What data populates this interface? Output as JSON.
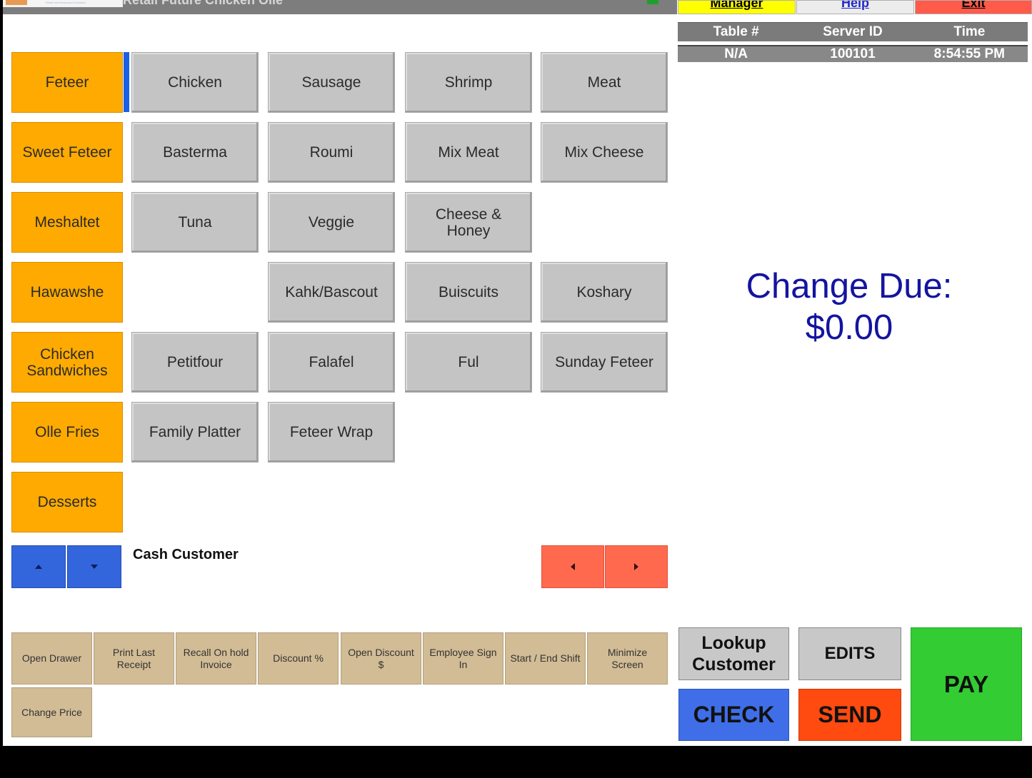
{
  "titlebar": {
    "app_title": "Retail Future  Chicken Ollé",
    "logo_tagline": "Retail and Restaurant Solutions"
  },
  "top_buttons": {
    "manager": "Manager",
    "help": "Help",
    "exit": "Exit"
  },
  "info_table": {
    "headers": [
      "Table #",
      "Server ID",
      "Time"
    ],
    "values": [
      "N/A",
      "100101",
      "8:54:55 PM"
    ]
  },
  "change_due": {
    "label": "Change Due:",
    "amount": "$0.00"
  },
  "categories": [
    "Feteer",
    "Sweet Feteer",
    "Meshaltet",
    "Hawawshe",
    "Chicken Sandwiches",
    "Olle Fries",
    "Desserts"
  ],
  "items": {
    "row1": [
      "Chicken",
      "Sausage",
      "Shrimp",
      "Meat"
    ],
    "row2": [
      "Basterma",
      "Roumi",
      "Mix Meat",
      "Mix Cheese"
    ],
    "row3": [
      "Tuna",
      "Veggie",
      "Cheese & Honey"
    ],
    "row4": [
      "Kahk/Bascout",
      "Buiscuits",
      "Koshary"
    ],
    "row5": [
      "Petitfour",
      "Falafel",
      "Ful",
      "Sunday Feteer"
    ],
    "row6": [
      "Family Platter",
      "Feteer Wrap"
    ]
  },
  "customer": {
    "name": "Cash Customer"
  },
  "function_buttons": [
    "Open Drawer",
    "Print Last Receipt",
    "Recall On hold Invoice",
    "Discount %",
    "Open Discount $",
    "Employee Sign In",
    "Start / End Shift",
    "Minimize Screen",
    "Change Price"
  ],
  "actions": {
    "lookup": "Lookup Customer",
    "edits": "EDITS",
    "check": "CHECK",
    "send": "SEND",
    "pay": "PAY"
  },
  "colors": {
    "category": "#ffaa00",
    "item": "#c4c4c4",
    "nav_blue": "#3366dd",
    "page_red": "#ff6a4f",
    "function": "#d2bc95",
    "check": "#3f6ee8",
    "send": "#ff4a10",
    "pay": "#33cc33",
    "change_due_text": "#1414a0"
  }
}
